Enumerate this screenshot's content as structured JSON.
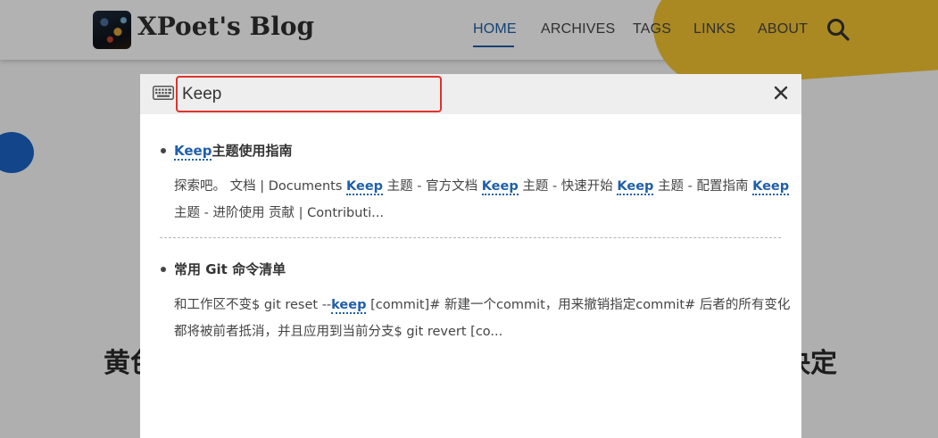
{
  "site": {
    "logo_text": "XPoet's Blog",
    "nav": [
      "HOME",
      "ARCHIVES",
      "TAGS",
      "LINKS",
      "ABOUT"
    ],
    "active_nav": "HOME",
    "bg_title_left": "黄色",
    "bg_title_right": "决定"
  },
  "search": {
    "query": "Keep",
    "placeholder": ""
  },
  "results": [
    {
      "title": [
        "Keep",
        "主题使用指南"
      ],
      "body_line1": [
        "探索吧。 文档 | Documents ",
        "Keep",
        " 主题 - 官方文档 ",
        "Keep",
        " 主题 - 快速开始 ",
        "Keep",
        " 主题 - 配置指南 ",
        "Keep"
      ],
      "body_line2": "主题 - 进阶使用 贡献 | Contributi..."
    },
    {
      "title": "常用 Git 命令清单",
      "body_line1": [
        "和工作区不变$ git reset --",
        "keep",
        " [commit]# 新建一个commit，用来撤销指定commit# 后者的所有变化"
      ],
      "body_line2": "都将被前者抵消，并且应用到当前分支$ git revert [co..."
    }
  ],
  "colors": {
    "accent": "#1f5fa8",
    "input_border": "#e0332b",
    "yellow": "#f4c531",
    "blue_dot": "#1a63c6"
  },
  "icons": [
    "search-icon",
    "keyboard-icon",
    "close-icon"
  ]
}
